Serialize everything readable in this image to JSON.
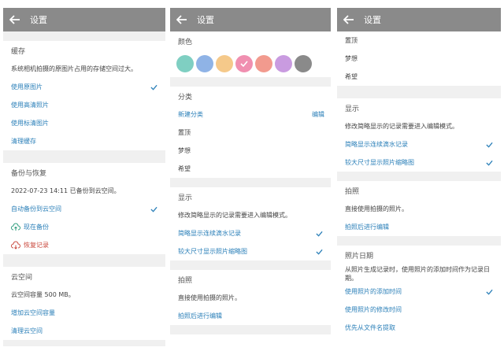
{
  "header_title": "设置",
  "colors": {
    "link": "#2a7fb8",
    "header_bg": "#8a8a8a",
    "swatches": [
      "#7fcfc2",
      "#8fb3e6",
      "#f5c98a",
      "#f08fb0",
      "#f29a8e",
      "#c99be0",
      "#8a8a8a"
    ],
    "selected_swatch_index": 3
  },
  "panel1": {
    "cache": {
      "title": "缓存",
      "desc": "系统相机拍摄的原图片占用的存储空间过大。",
      "opt_original": "使用原图片",
      "opt_hd": "使用高清照片",
      "opt_sd": "使用标清图片",
      "clear": "清理缓存"
    },
    "backup": {
      "title": "备份与恢复",
      "last": "2022-07-23 14:11 已备份到云空间。",
      "auto": "自动备份到云空间",
      "now": "现在备份",
      "restore": "恢复记录"
    },
    "cloud": {
      "title": "云空间",
      "capacity": "云空间容量 500 MB。",
      "increase": "增加云空间容量",
      "clear": "清理云空间"
    }
  },
  "panel2": {
    "color_title": "颜色",
    "category": {
      "title": "分类",
      "new": "新建分类",
      "edit": "编辑",
      "items": [
        "置顶",
        "梦想",
        "希望"
      ]
    },
    "display": {
      "title": "显示",
      "desc": "修改简略显示的记录需要进入编辑模式。",
      "opt1": "简略显示连续滴水记录",
      "opt2": "较大尺寸显示照片缩略图"
    },
    "photo": {
      "title": "拍照",
      "desc": "直接使用拍摄的照片。",
      "edit_after": "拍照后进行编辑"
    }
  },
  "panel3": {
    "items": [
      "置顶",
      "梦想",
      "希望"
    ],
    "display": {
      "title": "显示",
      "desc": "修改简略显示的记录需要进入编辑模式。",
      "opt1": "简略显示连续滴水记录",
      "opt2": "较大尺寸显示照片缩略图"
    },
    "photo": {
      "title": "拍照",
      "desc": "直接使用拍摄的照片。",
      "edit_after": "拍照后进行编辑"
    },
    "photo_date": {
      "title": "照片日期",
      "desc": "从照片生成记录时，使用照片的添加时间作为记录日期。",
      "opt_added": "使用照片的添加时间",
      "opt_modified": "使用照片的修改时间",
      "opt_filename": "优先从文件名提取"
    }
  }
}
